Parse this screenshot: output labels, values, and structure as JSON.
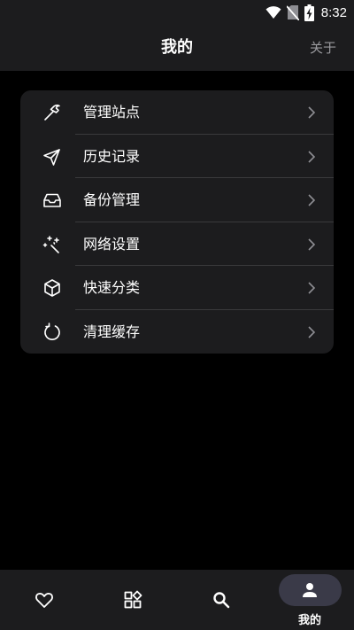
{
  "status_bar": {
    "time": "8:32",
    "icons": [
      "wifi-icon",
      "no-sim-icon",
      "battery-charging-icon"
    ]
  },
  "header": {
    "title": "我的",
    "about_label": "关于"
  },
  "menu": {
    "items": [
      {
        "label": "管理站点",
        "icon": "hammer-icon"
      },
      {
        "label": "历史记录",
        "icon": "send-icon"
      },
      {
        "label": "备份管理",
        "icon": "inbox-icon"
      },
      {
        "label": "网络设置",
        "icon": "sparkles-icon"
      },
      {
        "label": "快速分类",
        "icon": "cube-icon"
      },
      {
        "label": "清理缓存",
        "icon": "refresh-icon"
      }
    ]
  },
  "bottom_nav": {
    "items": [
      {
        "icon": "heart-icon",
        "label": ""
      },
      {
        "icon": "grid-icon",
        "label": ""
      },
      {
        "icon": "search-icon",
        "label": ""
      },
      {
        "icon": "person-icon",
        "label": "我的",
        "active": true
      }
    ]
  },
  "colors": {
    "background": "#000000",
    "surface": "#1c1c1e",
    "active_pill": "#3a3a48",
    "divider": "#3a3a3c",
    "secondary_text": "#9a9a9e"
  }
}
